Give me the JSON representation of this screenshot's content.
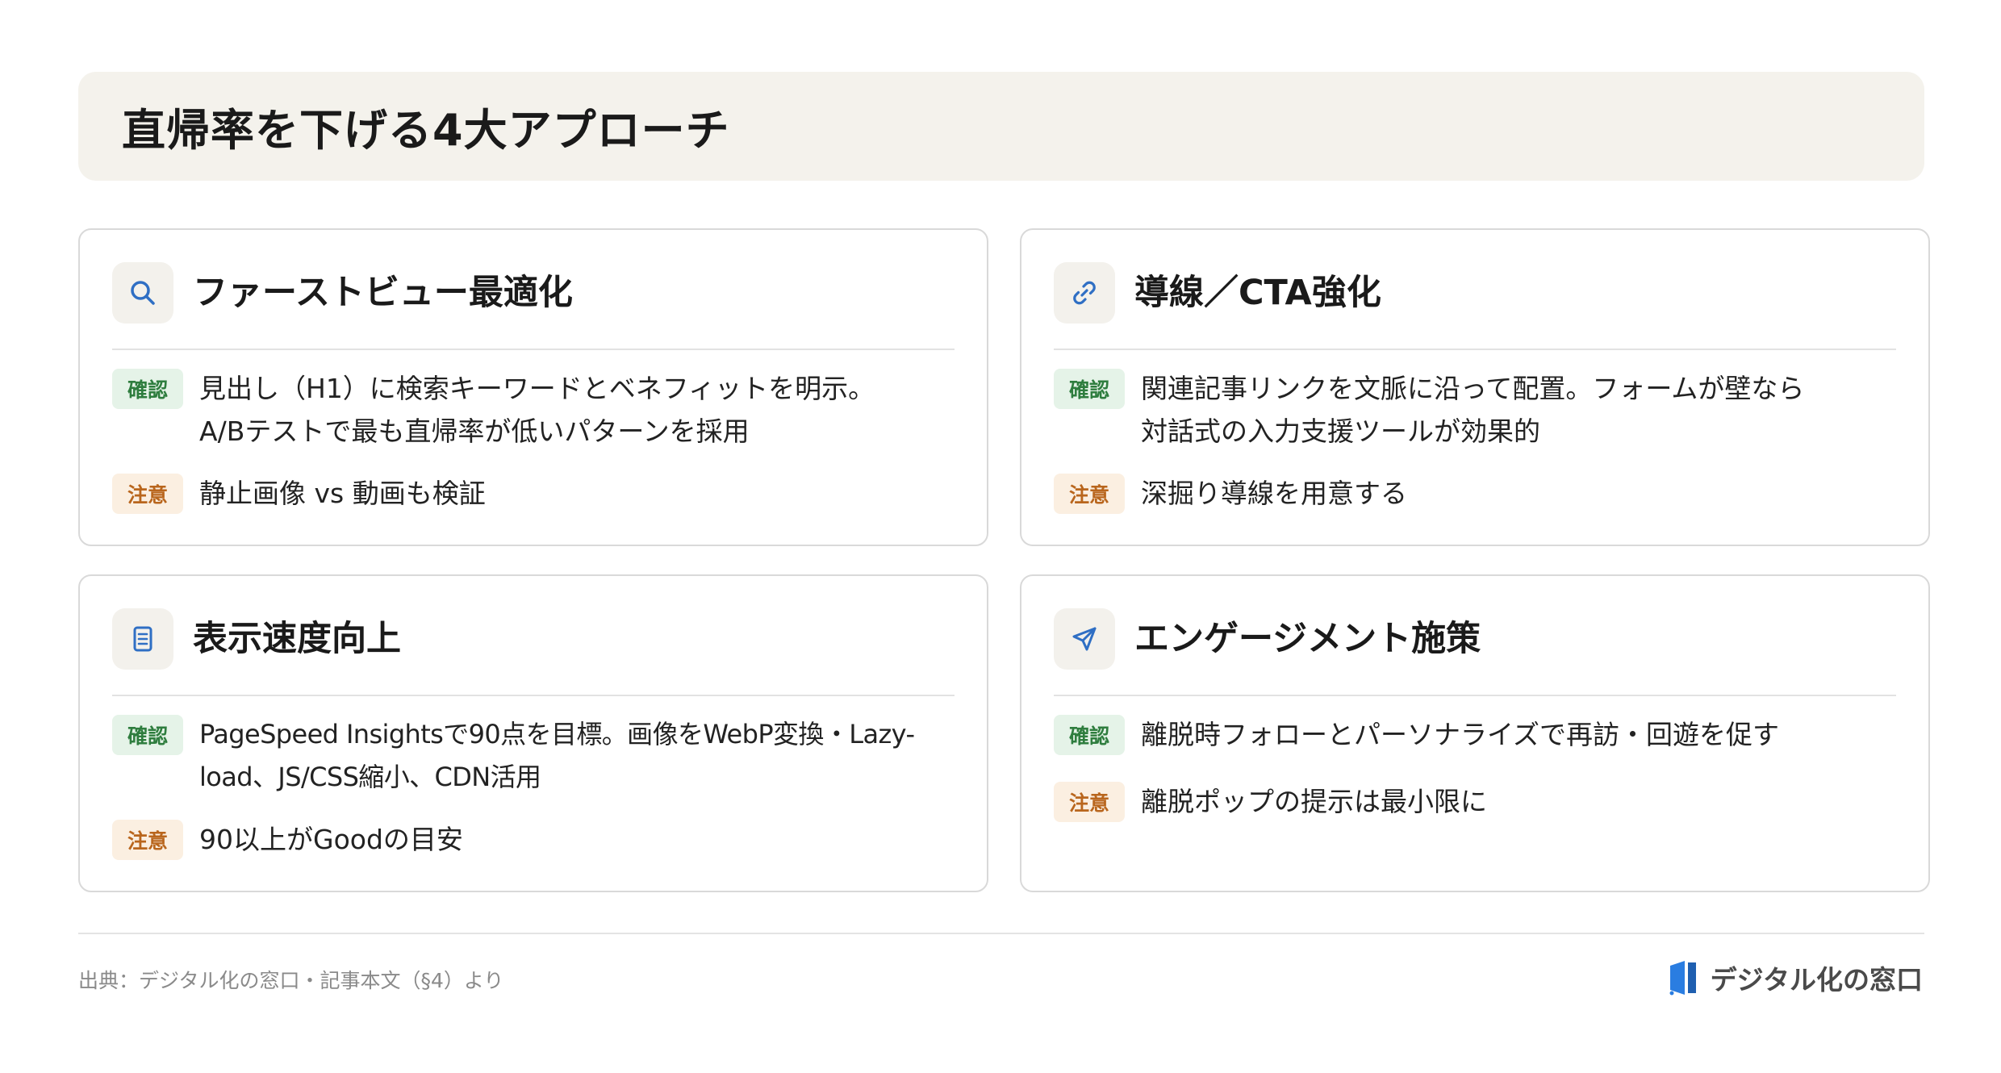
{
  "title": "直帰率を下げる4大アプローチ",
  "badges": {
    "confirm": "確認",
    "caution": "注意"
  },
  "cards": [
    {
      "icon": "search-icon",
      "title": "ファーストビュー最適化",
      "confirm": "見出し（H1）に検索キーワードとベネフィットを明示。\nA/Bテストで最も直帰率が低いパターンを採用",
      "caution": "静止画像 vs 動画も検証"
    },
    {
      "icon": "link-icon",
      "title": "導線／CTA強化",
      "confirm": "関連記事リンクを文脈に沿って配置。フォームが壁なら\n対話式の入力支援ツールが効果的",
      "caution": "深掘り導線を用意する"
    },
    {
      "icon": "document-icon",
      "title": "表示速度向上",
      "confirm": "PageSpeed Insightsで90点を目標。画像をWebP変換・Lazy-\nload、JS/CSS縮小、CDN活用",
      "caution": "90以上がGoodの目安"
    },
    {
      "icon": "send-icon",
      "title": "エンゲージメント施策",
      "confirm": "離脱時フォローとパーソナライズで再訪・回遊を促す",
      "caution": "離脱ポップの提示は最小限に"
    }
  ],
  "footer": {
    "source": "出典：デジタル化の窓口・記事本文（§4）より",
    "brand": "デジタル化の窓口"
  },
  "colors": {
    "icon_blue": "#2f6fc4",
    "confirm_green": "#2e7d3e",
    "caution_orange": "#b9661d",
    "brand_blue": "#2a7de1"
  }
}
